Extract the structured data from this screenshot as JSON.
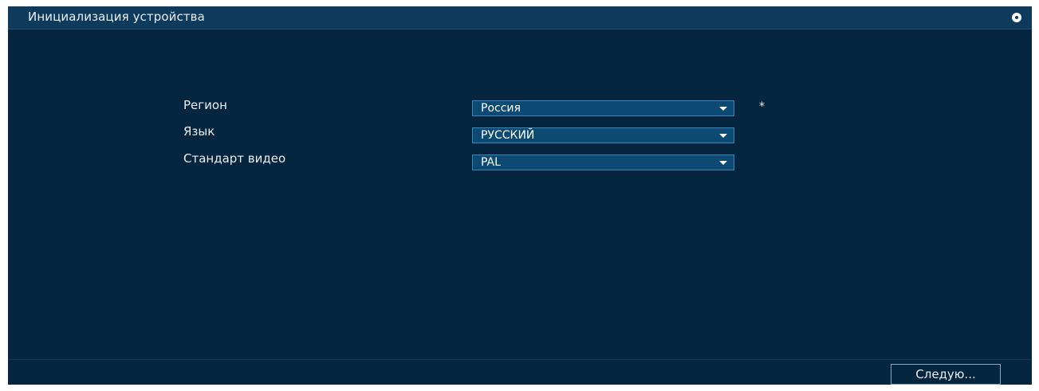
{
  "window": {
    "title": "Инициализация устройства",
    "power_icon": "power-icon"
  },
  "form": {
    "fields": [
      {
        "label": "Регион",
        "value": "Россия",
        "required_mark": "*"
      },
      {
        "label": "Язык",
        "value": "РУССКИЙ"
      },
      {
        "label": "Стандарт видео",
        "value": "PAL"
      }
    ]
  },
  "footer": {
    "next_label": "Следую..."
  },
  "colors": {
    "background": "#062640",
    "titlebar": "#0e3a5c",
    "select_bg": "#0d4a73",
    "select_border": "#3d86b8",
    "text": "#e8eef4"
  }
}
